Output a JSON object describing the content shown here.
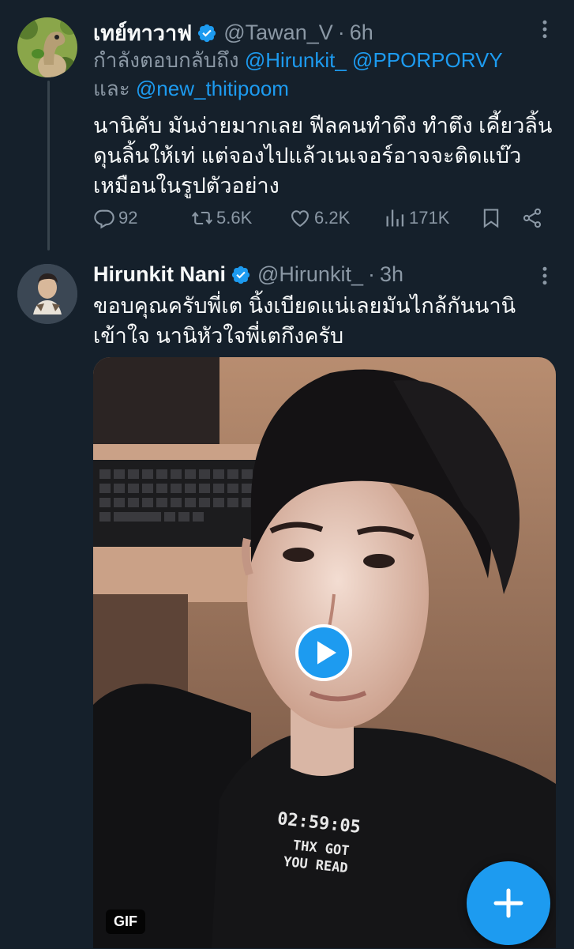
{
  "tweet1": {
    "display_name": "เทย์ทาวาฟ",
    "handle": "@Tawan_V",
    "separator": "·",
    "time": "6h",
    "reply_prefix": "กำลังตอบกลับถึง",
    "mentions": [
      "@Hirunkit_",
      "@PPORPORVY",
      "@new_thitipoom"
    ],
    "reply_and": "และ",
    "text_lines": [
      "นานิคับ มันง่ายมากเลย ฟีลคนทำดึง ทำตึง เคี้ยวลิ้น",
      "ดุนลิ้นให้เท่ แต่จองไปแล้วเนเจอร์อาจจะติดแบ๊ว",
      "เหมือนในรูปตัวอย่าง"
    ],
    "actions": {
      "replies": "92",
      "retweets": "5.6K",
      "likes": "6.2K",
      "views": "171K"
    }
  },
  "tweet2": {
    "display_name": "Hirunkit Nani",
    "handle": "@Hirunkit_",
    "separator": "·",
    "time": "3h",
    "text_lines": [
      "ขอบคุณครับพี่เต นิ้งเบียดแน่เลยมันไกล้กันนานิ",
      "เข้าใจ นานิหัวใจพี่เตกึงครับ"
    ],
    "media": {
      "badge": "GIF",
      "shirt_time": "02:59:05",
      "shirt_line1": "THX GOT",
      "shirt_line2": "YOU READ"
    }
  },
  "icons": {
    "verified": "verified-badge-icon",
    "more": "more-icon",
    "reply": "reply-icon",
    "retweet": "retweet-icon",
    "like": "like-icon",
    "views": "views-icon",
    "bookmark": "bookmark-icon",
    "share": "share-icon",
    "play": "play-icon",
    "compose": "plus-icon"
  },
  "colors": {
    "background": "#15202b",
    "accent": "#1d9bf0",
    "muted": "#8b98a5",
    "text": "#f7f9f9"
  }
}
